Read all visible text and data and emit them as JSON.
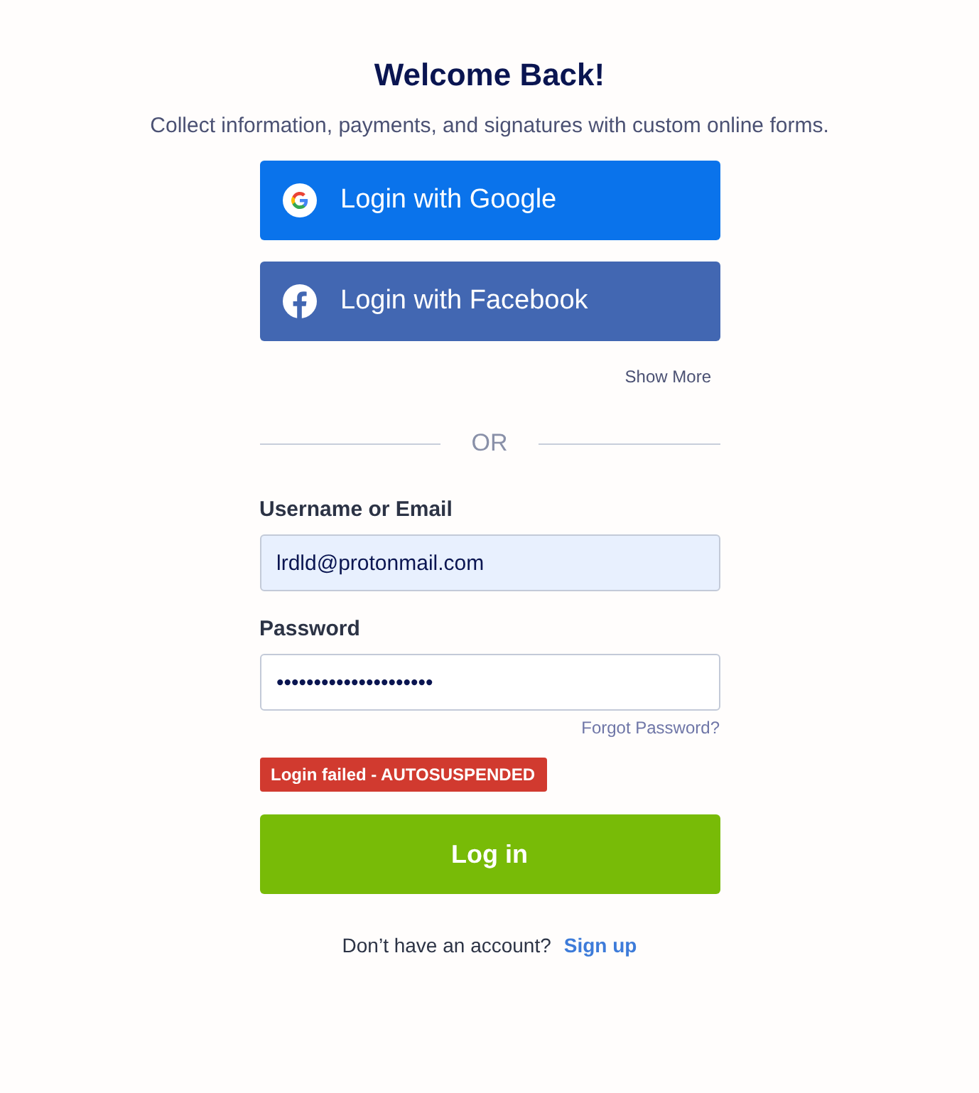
{
  "title": "Welcome Back!",
  "subtitle": "Collect information, payments, and signatures with custom online forms.",
  "social_buttons": [
    {
      "kind": "google",
      "label": "Login with Google"
    },
    {
      "kind": "facebook",
      "label": "Login with Facebook"
    }
  ],
  "show_more": "Show More",
  "divider": "OR",
  "fields": [
    {
      "label": "Username or Email",
      "value": "lrdld@protonmail.com",
      "autofilled": true
    },
    {
      "label": "Password",
      "value": "•••••••••••••••••••••",
      "autofilled": false
    }
  ],
  "forgot_password": "Forgot Password?",
  "error": "Login failed - AUTOSUSPENDED",
  "login_button": "Log in",
  "footer": {
    "text": "Don’t have an account?",
    "link": "Sign up"
  }
}
